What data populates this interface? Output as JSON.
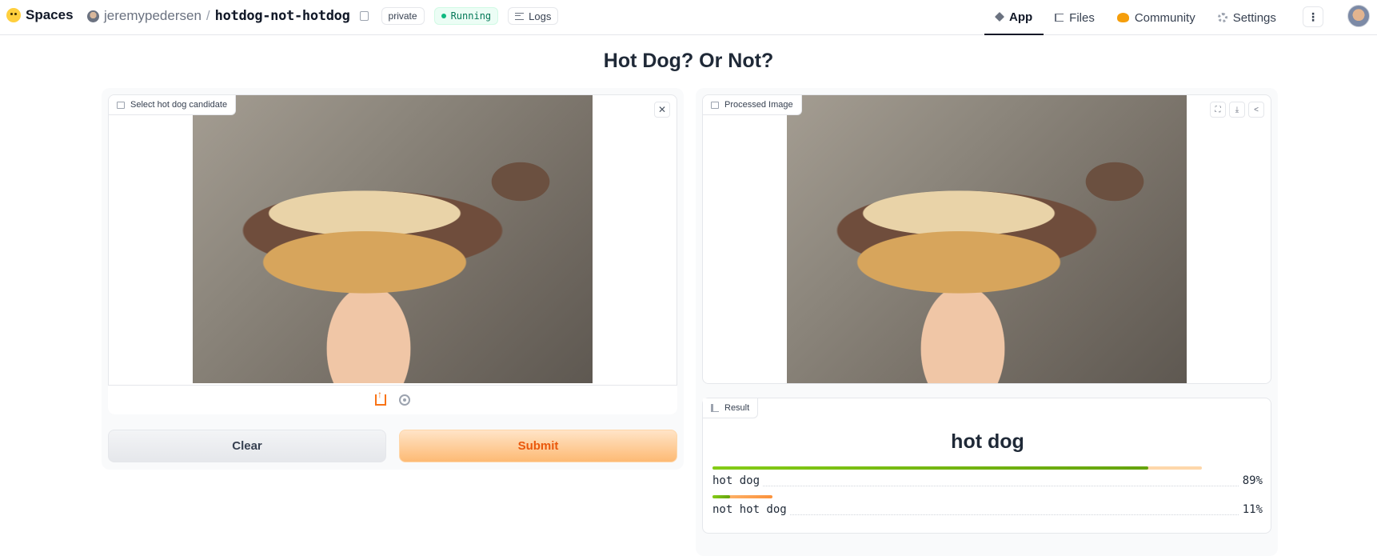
{
  "header": {
    "brand": "Spaces",
    "owner": "jeremypedersen",
    "separator": "/",
    "repo": "hotdog-not-hotdog",
    "visibility": "private",
    "status": "Running",
    "logs_label": "Logs",
    "status_color": "#10b981",
    "tabs": [
      {
        "label": "App",
        "icon": "cube-icon",
        "active": true
      },
      {
        "label": "Files",
        "icon": "files-icon"
      },
      {
        "label": "Community",
        "icon": "community-icon"
      },
      {
        "label": "Settings",
        "icon": "gear-icon"
      }
    ],
    "more_label": "⋮"
  },
  "app": {
    "title": "Hot Dog? Or Not?",
    "input": {
      "label": "Select hot dog candidate",
      "close_icon": "close-icon",
      "sources": [
        "upload-icon",
        "webcam-icon"
      ]
    },
    "buttons": {
      "clear": "Clear",
      "submit": "Submit"
    },
    "output_image": {
      "label": "Processed Image",
      "tools": [
        "fullscreen-icon",
        "download-icon",
        "share-icon"
      ]
    },
    "result": {
      "label": "Result",
      "top_label": "hot dog",
      "confidences": [
        {
          "label": "hot dog",
          "value_text": "89%",
          "value": 0.89
        },
        {
          "label": "not hot dog",
          "value_text": "11%",
          "value": 0.11
        }
      ]
    },
    "accent_color": "#f97316"
  }
}
